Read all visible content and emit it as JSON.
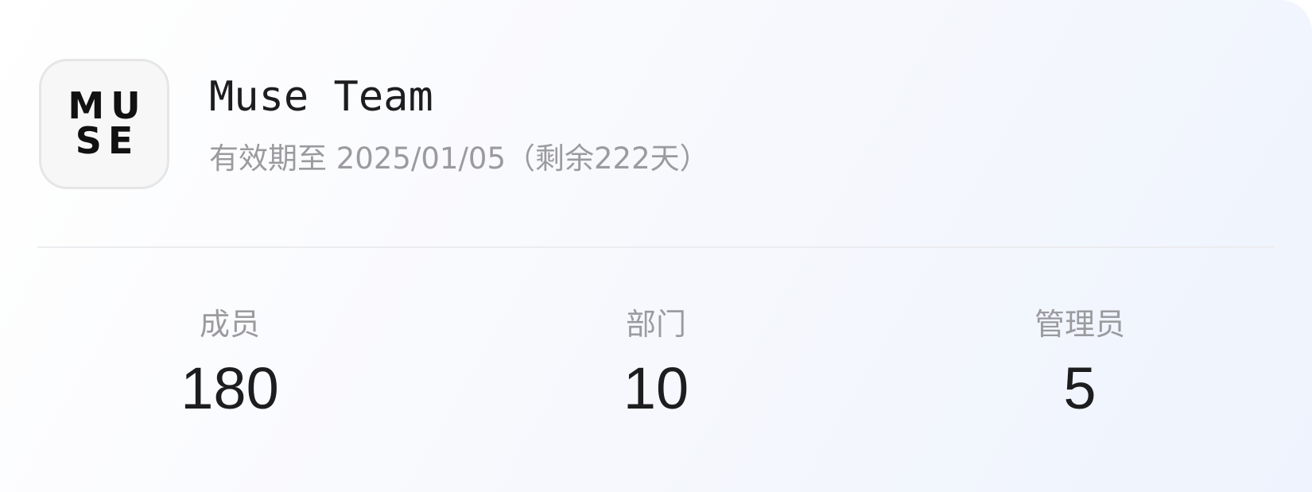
{
  "team": {
    "logo_lines": [
      "MU",
      "SE"
    ],
    "name": "Muse Team",
    "validity": "有效期至 2025/01/05（剩余222天）"
  },
  "stats": [
    {
      "label": "成员",
      "value": "180"
    },
    {
      "label": "部门",
      "value": "10"
    },
    {
      "label": "管理员",
      "value": "5"
    }
  ],
  "colors": {
    "title": "#1d1d1f",
    "muted": "#9b9b9f",
    "divider": "#ececf0",
    "logo_background": "#f7f7f7",
    "logo_border": "#e6e6e6"
  }
}
